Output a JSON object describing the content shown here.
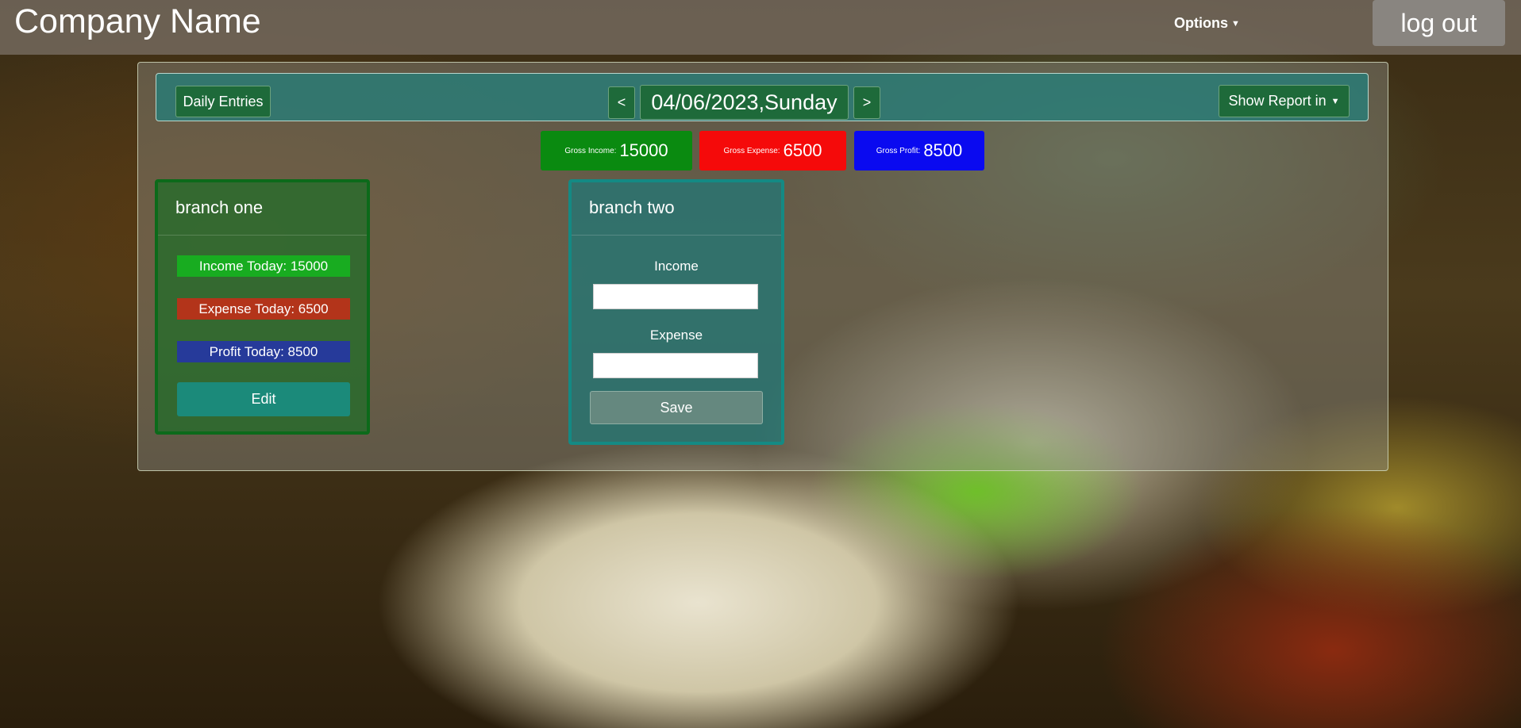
{
  "navbar": {
    "brand": "Company Name",
    "options_label": "Options",
    "logout_label": "log out"
  },
  "toolbar": {
    "daily_entries_label": "Daily Entries",
    "prev_label": "<",
    "date_label": "04/06/2023,Sunday",
    "next_label": ">",
    "show_report_label": "Show Report in"
  },
  "gross": {
    "income_label": "Gross Income:",
    "income_value": "15000",
    "expense_label": "Gross Expense:",
    "expense_value": "6500",
    "profit_label": "Gross Profit:",
    "profit_value": "8500"
  },
  "branches": [
    {
      "title": "branch one",
      "income_text": "Income Today: 15000",
      "expense_text": "Expense Today: 6500",
      "profit_text": "Profit Today: 8500",
      "edit_label": "Edit"
    },
    {
      "title": "branch two",
      "income_label": "Income",
      "income_value": "",
      "expense_label": "Expense",
      "expense_value": "",
      "save_label": "Save"
    }
  ],
  "colors": {
    "gross_income": "#0a8a10",
    "gross_expense": "#f50a0a",
    "gross_profit": "#0a0af0",
    "card_one_border": "#0c6a1a",
    "card_two_border": "#148a84"
  },
  "icons": {
    "options_caret": "caret-down-icon",
    "report_caret": "caret-down-icon"
  }
}
